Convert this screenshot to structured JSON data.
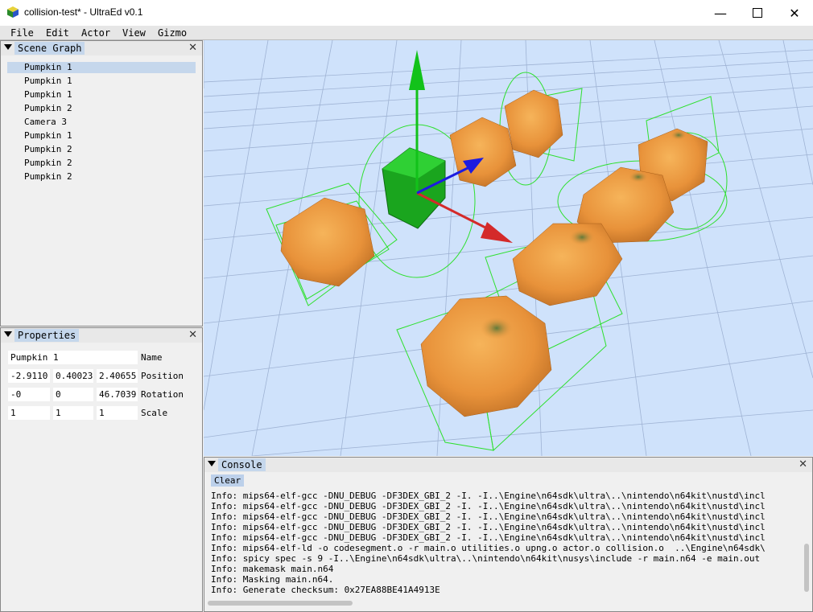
{
  "window": {
    "title": "collision-test* - UltraEd v0.1",
    "minimize_icon": "minimize-icon",
    "maximize_icon": "maximize-icon",
    "close_icon": "close-icon"
  },
  "menu": [
    "File",
    "Edit",
    "Actor",
    "View",
    "Gizmo"
  ],
  "scene_graph": {
    "tab": "Scene Graph",
    "items": [
      "Pumpkin 1",
      "Pumpkin 1",
      "Pumpkin 1",
      "Pumpkin 2",
      "Camera 3",
      "Pumpkin 1",
      "Pumpkin 2",
      "Pumpkin 2",
      "Pumpkin 2"
    ],
    "selected_index": 0
  },
  "properties": {
    "tab": "Properties",
    "name_value": "Pumpkin 1",
    "name_label": "Name",
    "position": [
      "-2.9110",
      "0.40023",
      "2.40655"
    ],
    "position_label": "Position",
    "rotation": [
      "-0",
      "0",
      "46.7039"
    ],
    "rotation_label": "Rotation",
    "scale": [
      "1",
      "1",
      "1"
    ],
    "scale_label": "Scale"
  },
  "viewport": {
    "gizmo_axis_colors": {
      "x": "#d42a2a",
      "y": "#12c21a",
      "z": "#1c1ce0"
    },
    "collider_color": "#2ee02e",
    "background_color": "#cfe2fb"
  },
  "console": {
    "tab": "Console",
    "clear_label": "Clear",
    "lines": [
      "Info: mips64-elf-gcc -DNU_DEBUG -DF3DEX_GBI_2 -I. -I..\\Engine\\n64sdk\\ultra\\..\\nintendo\\n64kit\\nustd\\incl",
      "Info: mips64-elf-gcc -DNU_DEBUG -DF3DEX_GBI_2 -I. -I..\\Engine\\n64sdk\\ultra\\..\\nintendo\\n64kit\\nustd\\incl",
      "Info: mips64-elf-gcc -DNU_DEBUG -DF3DEX_GBI_2 -I. -I..\\Engine\\n64sdk\\ultra\\..\\nintendo\\n64kit\\nustd\\incl",
      "Info: mips64-elf-gcc -DNU_DEBUG -DF3DEX_GBI_2 -I. -I..\\Engine\\n64sdk\\ultra\\..\\nintendo\\n64kit\\nustd\\incl",
      "Info: mips64-elf-gcc -DNU_DEBUG -DF3DEX_GBI_2 -I. -I..\\Engine\\n64sdk\\ultra\\..\\nintendo\\n64kit\\nustd\\incl",
      "Info: mips64-elf-ld -o codesegment.o -r main.o utilities.o upng.o actor.o collision.o  ..\\Engine\\n64sdk\\",
      "Info: spicy spec -s 9 -I..\\Engine\\n64sdk\\ultra\\..\\nintendo\\n64kit\\nusys\\include -r main.n64 -e main.out",
      "Info: makemask main.n64",
      "Info: Masking main.n64.",
      "Info: Generate checksum: 0x27EA88BE41A4913E"
    ]
  }
}
